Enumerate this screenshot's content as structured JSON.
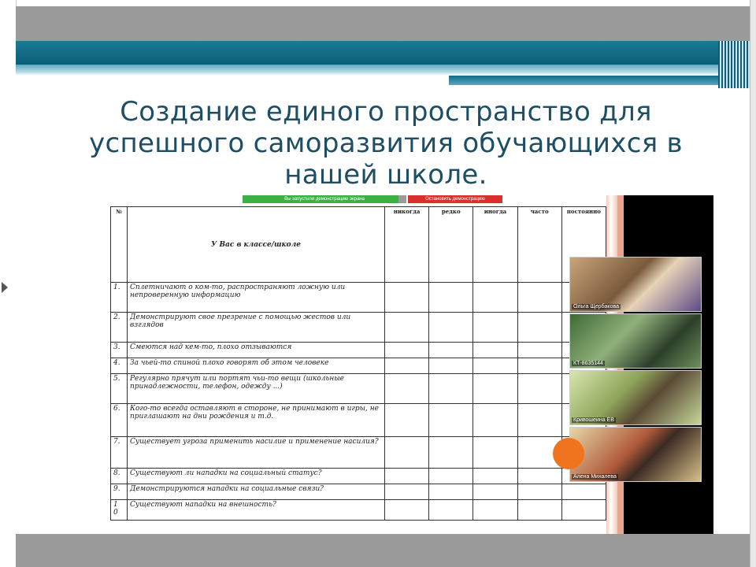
{
  "slide": {
    "title_line1": "Создание единого пространство для",
    "title_line2": "успешного саморазвития обучающихся в",
    "title_line3": "нашей школе."
  },
  "share_bar": {
    "status_text": "Вы запустили демонстрацию экрана",
    "stop_button": "Остановить демонстрацию"
  },
  "questionnaire": {
    "header": [
      "№",
      "У Вас в классе/школе",
      "никогда",
      "редко",
      "иногда",
      "часто",
      "постоянно"
    ],
    "rows": [
      {
        "num": "1.",
        "text": "Сплетничают о ком-то, распространяют ложную или непроверенную информацию"
      },
      {
        "num": "2.",
        "text": "Демонстрируют свое презрение с помощью жестов или взглядов"
      },
      {
        "num": "3.",
        "text": "Смеются над кем-то, плохо отзываются"
      },
      {
        "num": "4.",
        "text": "За чьей-то спиной плохо говорят об этом человеке"
      },
      {
        "num": "5.",
        "text": "Регулярно прячут или портят чьи-то вещи (школьные принадлежности, телефон, одежду ...)"
      },
      {
        "num": "6.",
        "text": "Кого-то всегда оставляют в стороне, не принимают в игры, не приглашают на дни рождения и т.д."
      },
      {
        "num": "7.",
        "text": "Существует угроза применить насилие и применение насилия?"
      },
      {
        "num": "8.",
        "text": "Существуют ли нападки на социальный статус?"
      },
      {
        "num": "9.",
        "text": "Демонстрируются нападки на социальные связи?"
      },
      {
        "num": "1\n0",
        "text": "Существуют нападки на внешность?"
      }
    ]
  },
  "participants": [
    {
      "name": "Ольга Щербакова"
    },
    {
      "name": "КТ-8635144"
    },
    {
      "name": "Кривошеина ЕВ"
    },
    {
      "name": "Алена Михалева"
    }
  ]
}
